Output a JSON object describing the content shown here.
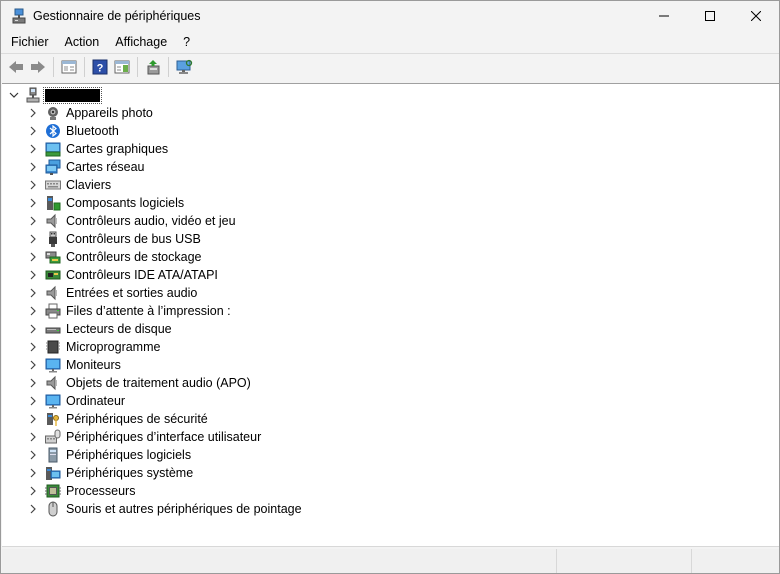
{
  "window": {
    "title": "Gestionnaire de périphériques",
    "title_icon": "device-manager-icon"
  },
  "window_controls": {
    "minimize_icon": "minimize-icon",
    "maximize_icon": "maximize-icon",
    "close_icon": "close-icon"
  },
  "menu": {
    "items": [
      "Fichier",
      "Action",
      "Affichage",
      "?"
    ]
  },
  "toolbar": {
    "buttons": [
      "back-icon",
      "forward-icon",
      "properties-pane-icon",
      "help-icon",
      "action-pane-icon",
      "update-driver-icon",
      "scan-hardware-icon"
    ]
  },
  "tree": {
    "root": {
      "name_redacted": true,
      "icon": "computer-icon",
      "expanded": true
    },
    "categories": [
      {
        "label": "Appareils photo",
        "icon": "camera-icon"
      },
      {
        "label": "Bluetooth",
        "icon": "bluetooth-icon"
      },
      {
        "label": "Cartes graphiques",
        "icon": "display-adapter-icon"
      },
      {
        "label": "Cartes réseau",
        "icon": "network-adapter-icon"
      },
      {
        "label": "Claviers",
        "icon": "keyboard-icon"
      },
      {
        "label": "Composants logiciels",
        "icon": "software-component-icon"
      },
      {
        "label": "Contrôleurs audio, vidéo et jeu",
        "icon": "speaker-icon"
      },
      {
        "label": "Contrôleurs de bus USB",
        "icon": "usb-icon"
      },
      {
        "label": "Contrôleurs de stockage",
        "icon": "storage-controller-icon"
      },
      {
        "label": "Contrôleurs IDE ATA/ATAPI",
        "icon": "ide-controller-icon"
      },
      {
        "label": "Entrées et sorties audio",
        "icon": "speaker-icon"
      },
      {
        "label": "Files d’attente à l’impression :",
        "icon": "printer-icon"
      },
      {
        "label": "Lecteurs de disque",
        "icon": "disk-drive-icon"
      },
      {
        "label": "Microprogramme",
        "icon": "firmware-icon"
      },
      {
        "label": "Moniteurs",
        "icon": "monitor-icon"
      },
      {
        "label": "Objets de traitement audio (APO)",
        "icon": "speaker-icon"
      },
      {
        "label": "Ordinateur",
        "icon": "monitor-icon"
      },
      {
        "label": "Périphériques de sécurité",
        "icon": "security-device-icon"
      },
      {
        "label": "Périphériques d’interface utilisateur",
        "icon": "hid-icon"
      },
      {
        "label": "Périphériques logiciels",
        "icon": "software-device-icon"
      },
      {
        "label": "Périphériques système",
        "icon": "system-device-icon"
      },
      {
        "label": "Processeurs",
        "icon": "processor-icon"
      },
      {
        "label": "Souris et autres périphériques de pointage",
        "icon": "mouse-icon"
      }
    ]
  }
}
